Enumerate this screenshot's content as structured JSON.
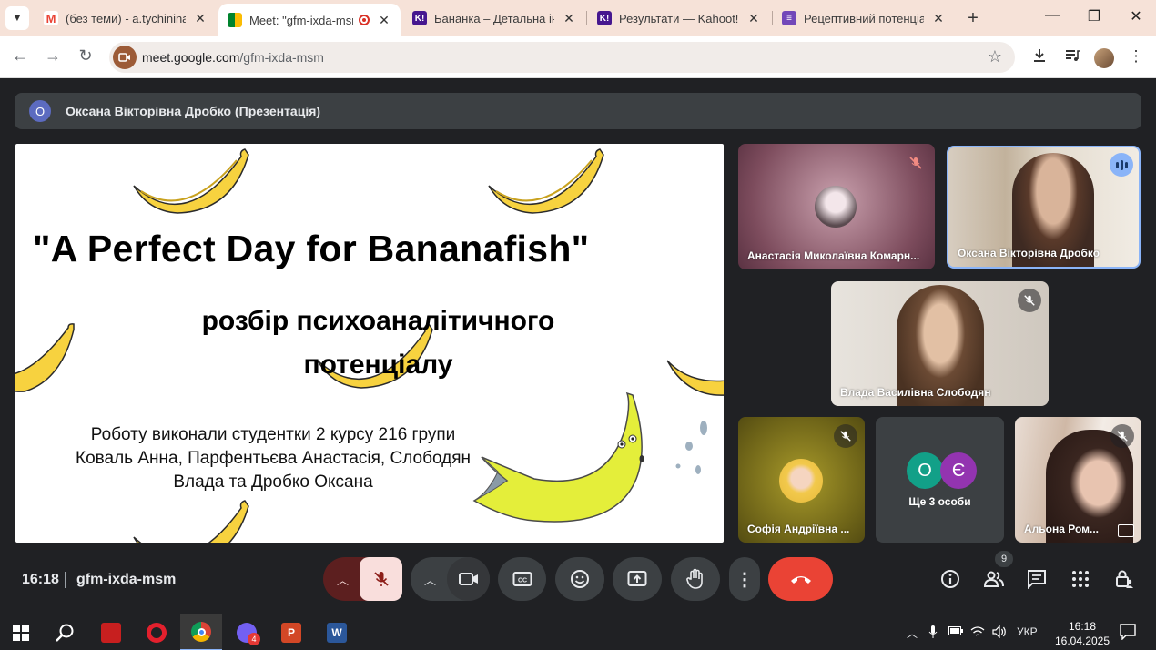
{
  "browser": {
    "tabs": [
      {
        "title": "(без теми) - a.tychinina@",
        "icon": "gmail-icon"
      },
      {
        "title": "Meet: \"gfm-ixda-msm",
        "icon": "meet-icon",
        "active": true
      },
      {
        "title": "Бананка – Детальна інф",
        "icon": "kahoot-icon"
      },
      {
        "title": "Результати — Kahoot!",
        "icon": "kahoot-icon"
      },
      {
        "title": "Рецептивний потенціал",
        "icon": "forms-icon"
      }
    ],
    "url_host": "meet.google.com",
    "url_path": "/gfm-ixda-msm"
  },
  "meet": {
    "presenter_initial": "О",
    "presenter_label": "Оксана Вікторівна Дробко (Презентація)",
    "slide": {
      "title": "\"A Perfect Day for Bananafish\"",
      "subtitle_line1": "розбір психоаналітичного",
      "subtitle_line2": "потенціалу",
      "authors_line1": "Роботу виконали студентки 2 курсу 216 групи",
      "authors_line2": "Коваль Анна, Парфентьєва Анастасія, Слободян",
      "authors_line3": "Влада та Дробко Оксана"
    },
    "participants": {
      "p1": "Анастасія Миколаївна Комарн...",
      "p2": "Оксана Вікторівна Дробко",
      "p3": "Влада Василівна Слободян",
      "p4": "Софія Андріївна ...",
      "more_initial_1": "О",
      "more_initial_2": "Є",
      "more_label": "Ще 3 особи",
      "p6": "Альона Ром..."
    },
    "time": "16:18",
    "meeting_code": "gfm-ixda-msm",
    "people_count": "9"
  },
  "taskbar": {
    "viber_badge": "4",
    "lang": "УКР",
    "time": "16:18",
    "date": "16.04.2025"
  },
  "colors": {
    "end_call": "#ea4335",
    "mic_off_bg": "#f9dedc",
    "tab_strip": "#f6e2d8"
  }
}
